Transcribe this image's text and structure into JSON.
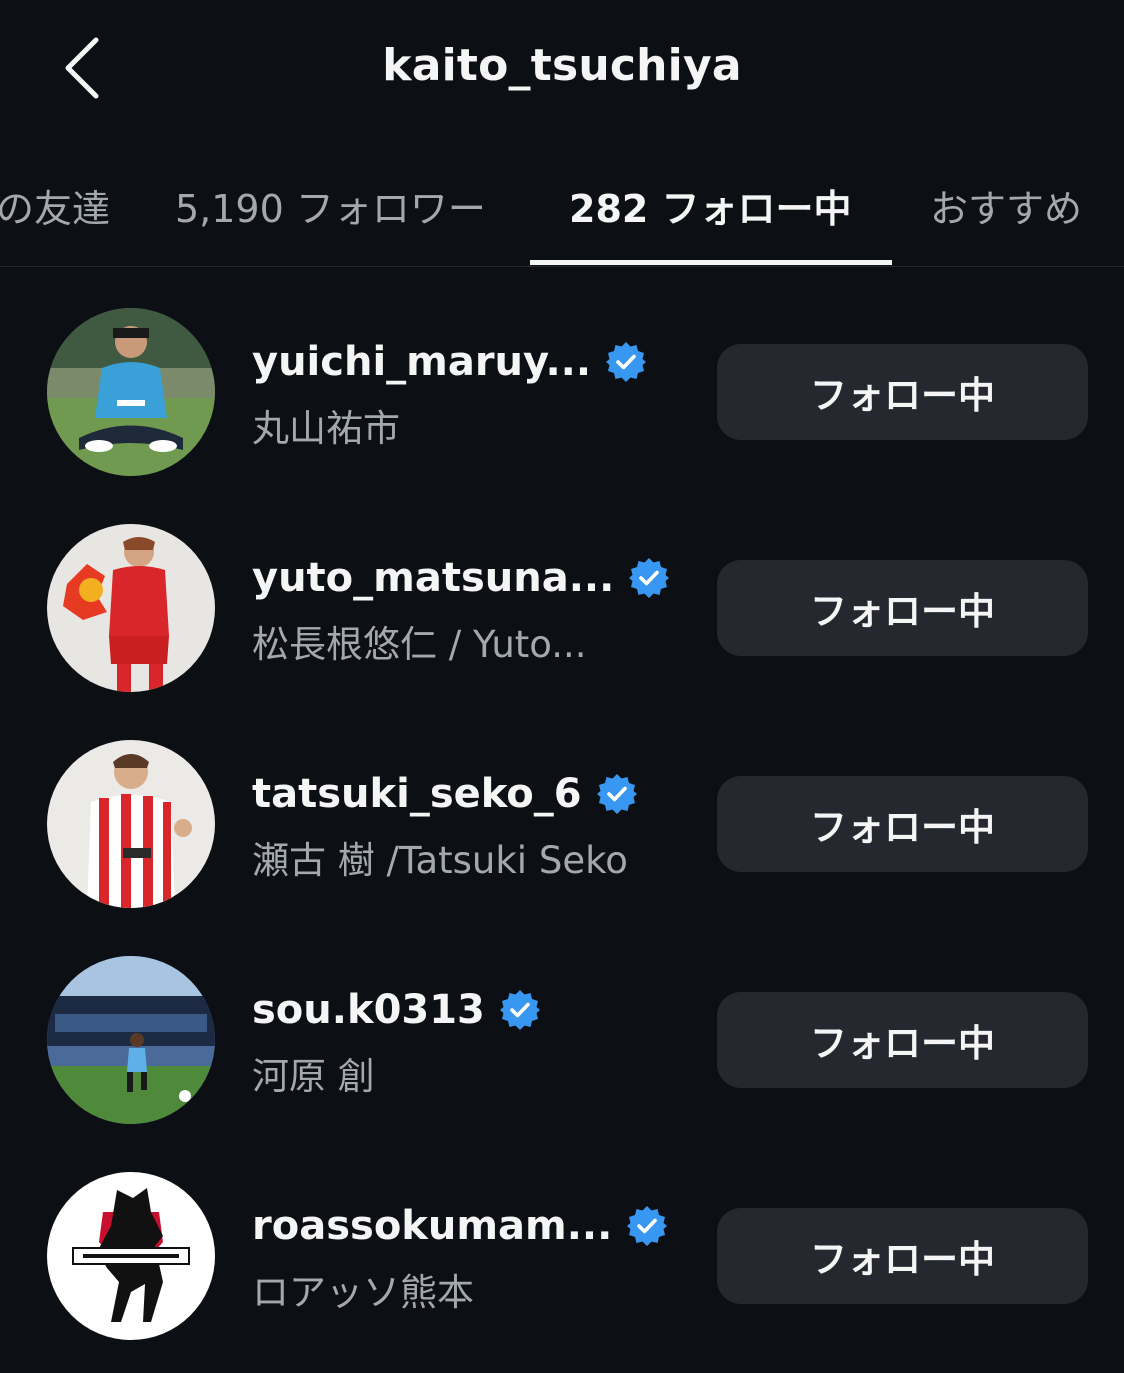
{
  "header": {
    "title": "kaito_tsuchiya",
    "back_icon": "chevron-left-icon"
  },
  "tabs": [
    {
      "label": "の友達",
      "active": false
    },
    {
      "label": "5,190 フォロワー",
      "active": false
    },
    {
      "label": "282 フォロー中",
      "active": true
    },
    {
      "label": "おすすめ",
      "active": false
    }
  ],
  "colors": {
    "background": "#0c0f14",
    "button_bg": "#25282e",
    "secondary_text": "#a3a7ae",
    "verified_blue": "#3897f0"
  },
  "accounts": [
    {
      "username": "yuichi_maruy...",
      "full_name": "丸山祐市",
      "verified": true,
      "button_label": "フォロー中",
      "avatar": "player-sitting-grass-avatar"
    },
    {
      "username": "yuto_matsuna...",
      "full_name": "松長根悠仁 / Yuto...",
      "verified": true,
      "button_label": "フォロー中",
      "avatar": "player-red-kit-mascot-avatar"
    },
    {
      "username": "tatsuki_seko_6",
      "full_name": "瀬古 樹 /Tatsuki Seko",
      "verified": true,
      "button_label": "フォロー中",
      "avatar": "player-striped-kit-avatar"
    },
    {
      "username": "sou.k0313",
      "full_name": "河原 創",
      "verified": true,
      "button_label": "フォロー中",
      "avatar": "player-stadium-action-avatar"
    },
    {
      "username": "roassokumam...",
      "full_name": "ロアッソ熊本",
      "verified": true,
      "button_label": "フォロー中",
      "avatar": "roasso-kumamoto-logo-avatar"
    }
  ]
}
